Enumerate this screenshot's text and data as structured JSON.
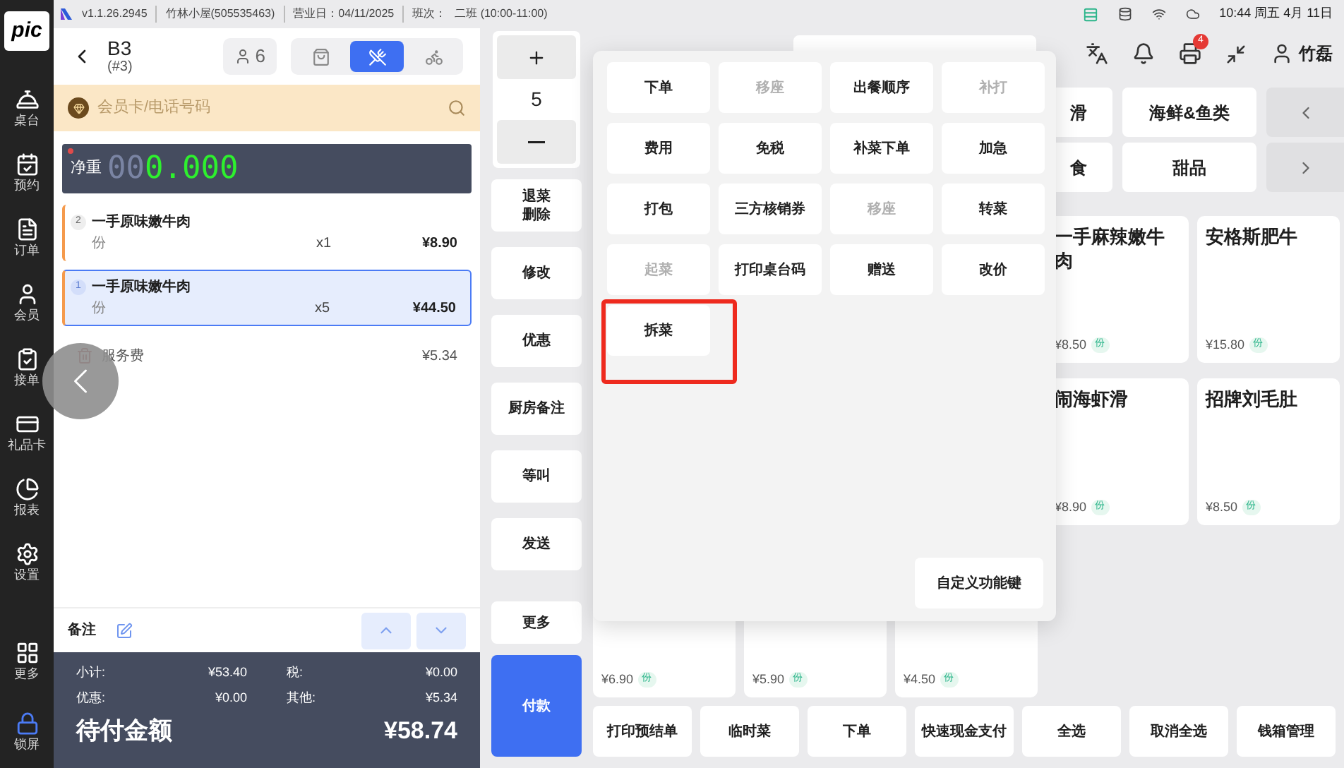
{
  "status_bar": {
    "version": "v1.1.26.2945",
    "store": "竹林小屋(505535463)",
    "business_day": "营业日：04/11/2025",
    "shift_label": "班次：",
    "shift": "二班 (10:00-11:00)",
    "clock": "10:44 周五 4月 11日"
  },
  "sidebar": {
    "logo": "pic",
    "items": [
      {
        "kind": "table",
        "label": "桌台"
      },
      {
        "kind": "reserve",
        "label": "预约"
      },
      {
        "kind": "orders",
        "label": "订单"
      },
      {
        "kind": "member",
        "label": "会员"
      },
      {
        "kind": "accept",
        "label": "接单"
      },
      {
        "kind": "giftcard",
        "label": "礼品卡"
      },
      {
        "kind": "report",
        "label": "报表"
      },
      {
        "kind": "settings",
        "label": "设置"
      }
    ],
    "bottom_items": [
      {
        "kind": "more",
        "label": "更多"
      },
      {
        "kind": "lock",
        "label": "锁屏"
      }
    ]
  },
  "order": {
    "table": "B3",
    "number": "(#3)",
    "guests": "6",
    "modes": [
      {
        "kind": "bag",
        "selected": false
      },
      {
        "kind": "dine",
        "selected": true
      },
      {
        "kind": "delivery",
        "selected": false
      }
    ],
    "member_placeholder": "会员卡/电话号码",
    "scale": {
      "label": "净重",
      "dim_digits": "00",
      "reading": "0.000"
    },
    "items": [
      {
        "index": "2",
        "name": "一手原味嫩牛肉",
        "unit": "份",
        "qty": "x1",
        "price": "¥8.90",
        "selected": false
      },
      {
        "index": "1",
        "name": "一手原味嫩牛肉",
        "unit": "份",
        "qty": "x5",
        "price": "¥44.50",
        "selected": true
      }
    ],
    "service_fee": {
      "label": "服务费",
      "amount": "¥5.34"
    },
    "note_label": "备注",
    "totals": [
      {
        "label": "小计:",
        "value": "¥53.40"
      },
      {
        "label": "税:",
        "value": "¥0.00"
      },
      {
        "label": "优惠:",
        "value": "¥0.00"
      },
      {
        "label": "其他:",
        "value": "¥5.34"
      }
    ],
    "due_label": "待付金额",
    "due": "¥58.74"
  },
  "actions": {
    "quantity": "5",
    "buttons": [
      {
        "label": "退菜删除",
        "kind": "stacked"
      },
      {
        "label": "修改",
        "kind": "plain"
      },
      {
        "label": "优惠",
        "kind": "plain"
      },
      {
        "label": "厨房备注",
        "kind": "plain"
      },
      {
        "label": "等叫",
        "kind": "plain"
      },
      {
        "label": "发送",
        "kind": "plain"
      }
    ],
    "more": "更多",
    "pay": "付款"
  },
  "toolbar": {
    "notification_badge": "4",
    "user": "竹磊"
  },
  "categories": [
    {
      "label": "滑"
    },
    {
      "label": "海鲜&鱼类"
    },
    {
      "label": "食"
    },
    {
      "label": "甜品"
    }
  ],
  "products": [
    {
      "name": "一手麻辣嫩牛肉",
      "price": "¥8.50",
      "unit": "份"
    },
    {
      "name": "安格斯肥牛",
      "price": "¥15.80",
      "unit": "份"
    },
    {
      "name": "闹海虾滑",
      "price": "¥8.90",
      "unit": "份"
    },
    {
      "name": "招牌刘毛肚",
      "price": "¥8.50",
      "unit": "份"
    },
    {
      "price": "¥6.90",
      "unit": "份"
    },
    {
      "price": "¥5.90",
      "unit": "份"
    },
    {
      "price": "¥4.50",
      "unit": "份"
    }
  ],
  "popup": {
    "buttons": [
      {
        "label": "下单",
        "disabled": false,
        "highlighted": false
      },
      {
        "label": "移座",
        "disabled": true,
        "highlighted": false
      },
      {
        "label": "出餐顺序",
        "disabled": false,
        "highlighted": false
      },
      {
        "label": "补打",
        "disabled": true,
        "highlighted": false
      },
      {
        "label": "费用",
        "disabled": false,
        "highlighted": false
      },
      {
        "label": "免税",
        "disabled": false,
        "highlighted": false
      },
      {
        "label": "补菜下单",
        "disabled": false,
        "highlighted": false
      },
      {
        "label": "加急",
        "disabled": false,
        "highlighted": false
      },
      {
        "label": "打包",
        "disabled": false,
        "highlighted": false
      },
      {
        "label": "三方核销券",
        "disabled": false,
        "highlighted": false
      },
      {
        "label": "移座",
        "disabled": true,
        "highlighted": false
      },
      {
        "label": "转菜",
        "disabled": false,
        "highlighted": false
      },
      {
        "label": "起菜",
        "disabled": true,
        "highlighted": false
      },
      {
        "label": "打印桌台码",
        "disabled": false,
        "highlighted": false
      },
      {
        "label": "赠送",
        "disabled": false,
        "highlighted": false
      },
      {
        "label": "改价",
        "disabled": false,
        "highlighted": false
      },
      {
        "label": "拆菜",
        "disabled": false,
        "highlighted": true
      }
    ],
    "custom": "自定义功能键"
  },
  "bottom_bar": [
    "打印预结单",
    "临时菜",
    "下单",
    "快速现金支付",
    "全选",
    "取消全选",
    "钱箱管理"
  ]
}
